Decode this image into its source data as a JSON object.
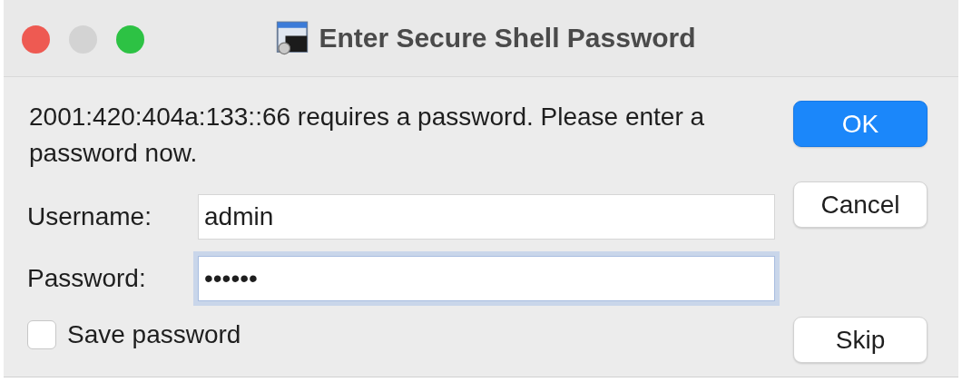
{
  "window": {
    "title": "Enter Secure Shell Password"
  },
  "message": "2001:420:404a:133::66 requires a password. Please enter a password now.",
  "fields": [
    {
      "label": "Username:",
      "value": "admin",
      "focused": false
    },
    {
      "label": "Password:",
      "value": "••••••",
      "focused": true
    }
  ],
  "save_password": {
    "label": "Save password",
    "checked": false
  },
  "buttons": [
    {
      "label": "OK",
      "default": true
    },
    {
      "label": "Cancel",
      "default": false
    },
    {
      "label": "Skip",
      "default": false
    }
  ]
}
